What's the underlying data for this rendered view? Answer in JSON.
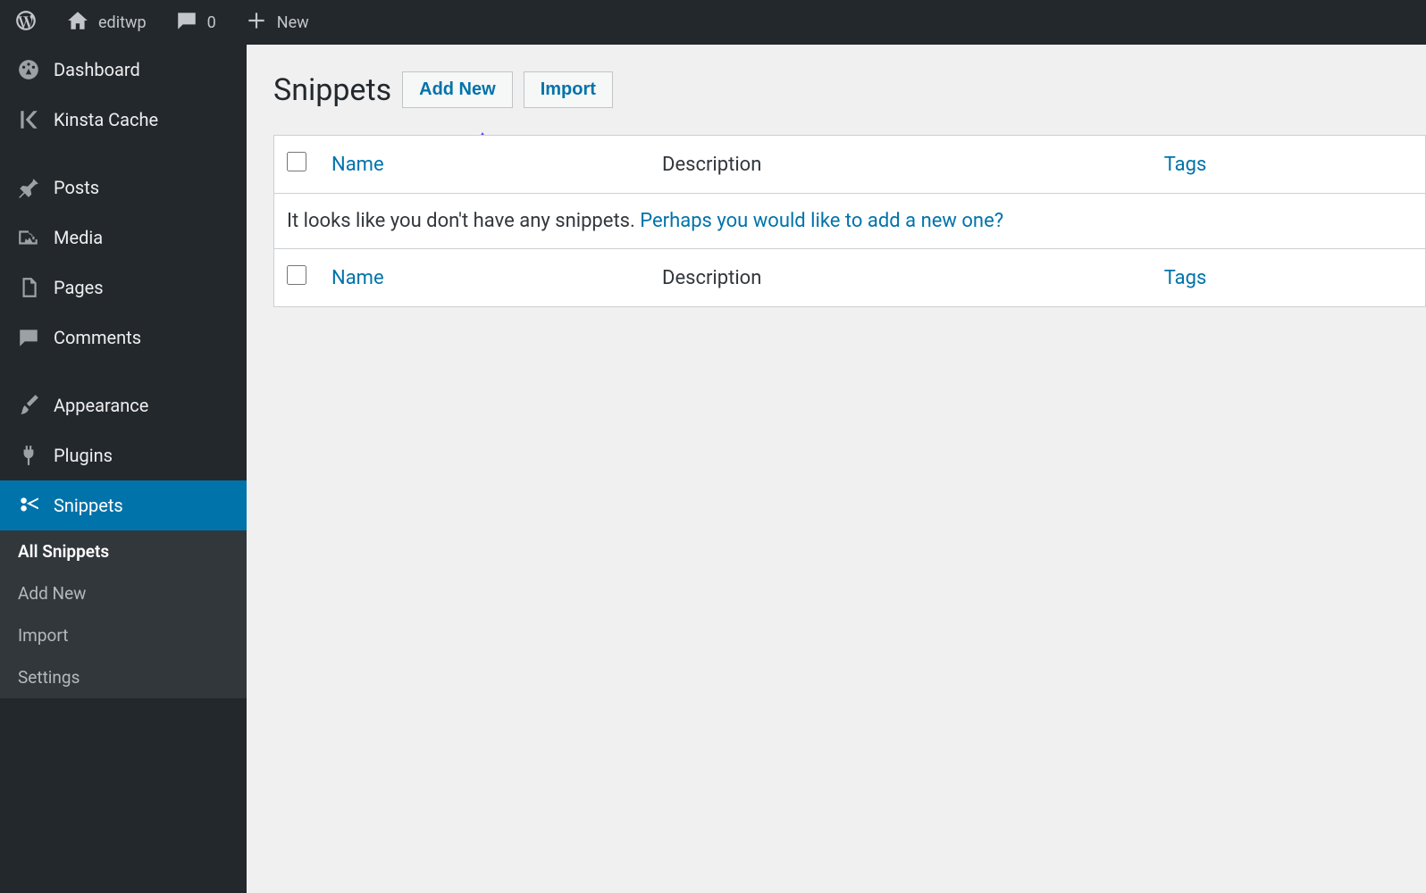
{
  "topbar": {
    "site_name": "editwp",
    "comments_count": "0",
    "new_label": "New"
  },
  "sidebar": {
    "items": [
      {
        "label": "Dashboard",
        "icon": "dashboard"
      },
      {
        "label": "Kinsta Cache",
        "icon": "kinsta"
      },
      {
        "label": "Posts",
        "icon": "pin"
      },
      {
        "label": "Media",
        "icon": "media"
      },
      {
        "label": "Pages",
        "icon": "pages"
      },
      {
        "label": "Comments",
        "icon": "comment"
      },
      {
        "label": "Appearance",
        "icon": "brush"
      },
      {
        "label": "Plugins",
        "icon": "plug"
      },
      {
        "label": "Snippets",
        "icon": "scissors"
      }
    ],
    "subitems": [
      {
        "label": "All Snippets"
      },
      {
        "label": "Add New"
      },
      {
        "label": "Import"
      },
      {
        "label": "Settings"
      }
    ]
  },
  "main": {
    "page_title": "Snippets",
    "add_new_label": "Add New",
    "import_label": "Import",
    "columns": {
      "name": "Name",
      "description": "Description",
      "tags": "Tags"
    },
    "empty_text": "It looks like you don't have any snippets. ",
    "empty_link": "Perhaps you would like to add a new one?"
  }
}
